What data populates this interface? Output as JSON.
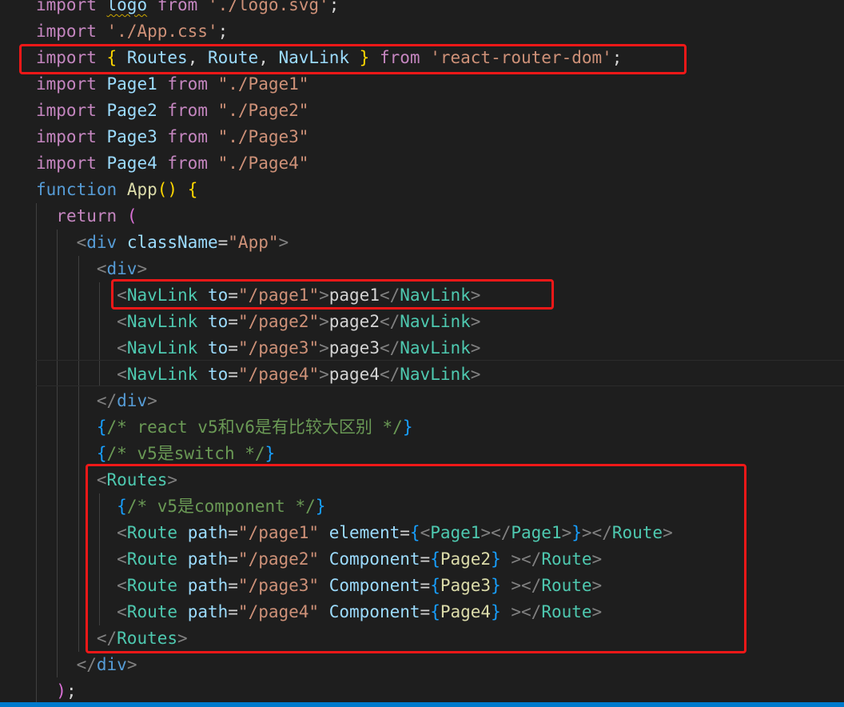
{
  "editor": {
    "language": "jsx",
    "theme_colors": {
      "background": "#1e1e1e",
      "keyword": "#c586c0",
      "storage": "#569cd6",
      "variable": "#9cdcfe",
      "function": "#dcdcaa",
      "string": "#ce9178",
      "component": "#4ec9b0",
      "comment": "#6a9955",
      "punctuation": "#808080",
      "text": "#d4d4d4",
      "bracket_gold": "#ffd700",
      "bracket_purple": "#da70d6",
      "bracket_blue": "#179fff",
      "highlight_box": "#f01818",
      "status_bar": "#007acc"
    },
    "lines": [
      [
        {
          "t": "import",
          "c": "keyword"
        },
        {
          "t": " "
        },
        {
          "t": "logo",
          "c": "variable",
          "squiggle": true
        },
        {
          "t": " "
        },
        {
          "t": "from",
          "c": "keyword"
        },
        {
          "t": " "
        },
        {
          "t": "'./logo.svg'",
          "c": "string"
        },
        {
          "t": ";"
        }
      ],
      [
        {
          "t": "import",
          "c": "keyword"
        },
        {
          "t": " "
        },
        {
          "t": "'./App.css'",
          "c": "string"
        },
        {
          "t": ";"
        }
      ],
      [
        {
          "t": "import",
          "c": "keyword"
        },
        {
          "t": " "
        },
        {
          "t": "{",
          "c": "bracket_gold"
        },
        {
          "t": " "
        },
        {
          "t": "Routes",
          "c": "variable"
        },
        {
          "t": ", "
        },
        {
          "t": "Route",
          "c": "variable"
        },
        {
          "t": ", "
        },
        {
          "t": "NavLink",
          "c": "variable"
        },
        {
          "t": " "
        },
        {
          "t": "}",
          "c": "bracket_gold"
        },
        {
          "t": " "
        },
        {
          "t": "from",
          "c": "keyword"
        },
        {
          "t": " "
        },
        {
          "t": "'react-router-dom'",
          "c": "string"
        },
        {
          "t": ";"
        }
      ],
      [
        {
          "t": "import",
          "c": "keyword"
        },
        {
          "t": " "
        },
        {
          "t": "Page1",
          "c": "variable"
        },
        {
          "t": " "
        },
        {
          "t": "from",
          "c": "keyword"
        },
        {
          "t": " "
        },
        {
          "t": "\"./Page1\"",
          "c": "string"
        }
      ],
      [
        {
          "t": "import",
          "c": "keyword"
        },
        {
          "t": " "
        },
        {
          "t": "Page2",
          "c": "variable"
        },
        {
          "t": " "
        },
        {
          "t": "from",
          "c": "keyword"
        },
        {
          "t": " "
        },
        {
          "t": "\"./Page2\"",
          "c": "string"
        }
      ],
      [
        {
          "t": "import",
          "c": "keyword"
        },
        {
          "t": " "
        },
        {
          "t": "Page3",
          "c": "variable"
        },
        {
          "t": " "
        },
        {
          "t": "from",
          "c": "keyword"
        },
        {
          "t": " "
        },
        {
          "t": "\"./Page3\"",
          "c": "string"
        }
      ],
      [
        {
          "t": "import",
          "c": "keyword"
        },
        {
          "t": " "
        },
        {
          "t": "Page4",
          "c": "variable"
        },
        {
          "t": " "
        },
        {
          "t": "from",
          "c": "keyword"
        },
        {
          "t": " "
        },
        {
          "t": "\"./Page4\"",
          "c": "string"
        }
      ],
      [
        {
          "t": "function",
          "c": "storage"
        },
        {
          "t": " "
        },
        {
          "t": "App",
          "c": "function"
        },
        {
          "t": "()",
          "c": "bracket_gold"
        },
        {
          "t": " "
        },
        {
          "t": "{",
          "c": "bracket_gold"
        }
      ],
      [
        {
          "t": "  "
        },
        {
          "t": "return",
          "c": "keyword"
        },
        {
          "t": " "
        },
        {
          "t": "(",
          "c": "bracket_purple"
        }
      ],
      [
        {
          "t": "    "
        },
        {
          "t": "<",
          "c": "punctuation"
        },
        {
          "t": "div",
          "c": "storage"
        },
        {
          "t": " "
        },
        {
          "t": "className",
          "c": "variable"
        },
        {
          "t": "="
        },
        {
          "t": "\"App\"",
          "c": "string"
        },
        {
          "t": ">",
          "c": "punctuation"
        }
      ],
      [
        {
          "t": "      "
        },
        {
          "t": "<",
          "c": "punctuation"
        },
        {
          "t": "div",
          "c": "storage"
        },
        {
          "t": ">",
          "c": "punctuation"
        }
      ],
      [
        {
          "t": "        "
        },
        {
          "t": "<",
          "c": "punctuation"
        },
        {
          "t": "NavLink",
          "c": "component"
        },
        {
          "t": " "
        },
        {
          "t": "to",
          "c": "variable"
        },
        {
          "t": "="
        },
        {
          "t": "\"/page1\"",
          "c": "string"
        },
        {
          "t": ">",
          "c": "punctuation"
        },
        {
          "t": "page1"
        },
        {
          "t": "</",
          "c": "punctuation"
        },
        {
          "t": "NavLink",
          "c": "component"
        },
        {
          "t": ">",
          "c": "punctuation"
        }
      ],
      [
        {
          "t": "        "
        },
        {
          "t": "<",
          "c": "punctuation"
        },
        {
          "t": "NavLink",
          "c": "component"
        },
        {
          "t": " "
        },
        {
          "t": "to",
          "c": "variable"
        },
        {
          "t": "="
        },
        {
          "t": "\"/page2\"",
          "c": "string"
        },
        {
          "t": ">",
          "c": "punctuation"
        },
        {
          "t": "page2"
        },
        {
          "t": "</",
          "c": "punctuation"
        },
        {
          "t": "NavLink",
          "c": "component"
        },
        {
          "t": ">",
          "c": "punctuation"
        }
      ],
      [
        {
          "t": "        "
        },
        {
          "t": "<",
          "c": "punctuation"
        },
        {
          "t": "NavLink",
          "c": "component"
        },
        {
          "t": " "
        },
        {
          "t": "to",
          "c": "variable"
        },
        {
          "t": "="
        },
        {
          "t": "\"/page3\"",
          "c": "string"
        },
        {
          "t": ">",
          "c": "punctuation"
        },
        {
          "t": "page3"
        },
        {
          "t": "</",
          "c": "punctuation"
        },
        {
          "t": "NavLink",
          "c": "component"
        },
        {
          "t": ">",
          "c": "punctuation"
        }
      ],
      [
        {
          "t": "        "
        },
        {
          "t": "<",
          "c": "punctuation"
        },
        {
          "t": "NavLink",
          "c": "component"
        },
        {
          "t": " "
        },
        {
          "t": "to",
          "c": "variable"
        },
        {
          "t": "="
        },
        {
          "t": "\"/page4\"",
          "c": "string"
        },
        {
          "t": ">",
          "c": "punctuation"
        },
        {
          "t": "page4"
        },
        {
          "t": "</",
          "c": "punctuation"
        },
        {
          "t": "NavLink",
          "c": "component"
        },
        {
          "t": ">",
          "c": "punctuation"
        }
      ],
      [
        {
          "t": "      "
        },
        {
          "t": "</",
          "c": "punctuation"
        },
        {
          "t": "div",
          "c": "storage"
        },
        {
          "t": ">",
          "c": "punctuation"
        }
      ],
      [
        {
          "t": "      "
        },
        {
          "t": "{",
          "c": "bracket_blue"
        },
        {
          "t": "/* react v5和v6是有比较大区别 */",
          "c": "comment"
        },
        {
          "t": "}",
          "c": "bracket_blue"
        }
      ],
      [
        {
          "t": "      "
        },
        {
          "t": "{",
          "c": "bracket_blue"
        },
        {
          "t": "/* v5是switch */",
          "c": "comment"
        },
        {
          "t": "}",
          "c": "bracket_blue"
        }
      ],
      [
        {
          "t": "      "
        },
        {
          "t": "<",
          "c": "punctuation"
        },
        {
          "t": "Routes",
          "c": "component"
        },
        {
          "t": ">",
          "c": "punctuation"
        }
      ],
      [
        {
          "t": "        "
        },
        {
          "t": "{",
          "c": "bracket_blue"
        },
        {
          "t": "/* v5是component */",
          "c": "comment"
        },
        {
          "t": "}",
          "c": "bracket_blue"
        }
      ],
      [
        {
          "t": "        "
        },
        {
          "t": "<",
          "c": "punctuation"
        },
        {
          "t": "Route",
          "c": "component"
        },
        {
          "t": " "
        },
        {
          "t": "path",
          "c": "variable"
        },
        {
          "t": "="
        },
        {
          "t": "\"/page1\"",
          "c": "string"
        },
        {
          "t": " "
        },
        {
          "t": "element",
          "c": "variable"
        },
        {
          "t": "="
        },
        {
          "t": "{",
          "c": "bracket_blue"
        },
        {
          "t": "<",
          "c": "punctuation"
        },
        {
          "t": "Page1",
          "c": "component"
        },
        {
          "t": "></",
          "c": "punctuation"
        },
        {
          "t": "Page1",
          "c": "component"
        },
        {
          "t": ">",
          "c": "punctuation"
        },
        {
          "t": "}",
          "c": "bracket_blue"
        },
        {
          "t": "></",
          "c": "punctuation"
        },
        {
          "t": "Route",
          "c": "component"
        },
        {
          "t": ">",
          "c": "punctuation"
        }
      ],
      [
        {
          "t": "        "
        },
        {
          "t": "<",
          "c": "punctuation"
        },
        {
          "t": "Route",
          "c": "component"
        },
        {
          "t": " "
        },
        {
          "t": "path",
          "c": "variable"
        },
        {
          "t": "="
        },
        {
          "t": "\"/page2\"",
          "c": "string"
        },
        {
          "t": " "
        },
        {
          "t": "Component",
          "c": "variable"
        },
        {
          "t": "="
        },
        {
          "t": "{",
          "c": "bracket_blue"
        },
        {
          "t": "Page2",
          "c": "function"
        },
        {
          "t": "}",
          "c": "bracket_blue"
        },
        {
          "t": " "
        },
        {
          "t": "></",
          "c": "punctuation"
        },
        {
          "t": "Route",
          "c": "component"
        },
        {
          "t": ">",
          "c": "punctuation"
        }
      ],
      [
        {
          "t": "        "
        },
        {
          "t": "<",
          "c": "punctuation"
        },
        {
          "t": "Route",
          "c": "component"
        },
        {
          "t": " "
        },
        {
          "t": "path",
          "c": "variable"
        },
        {
          "t": "="
        },
        {
          "t": "\"/page3\"",
          "c": "string"
        },
        {
          "t": " "
        },
        {
          "t": "Component",
          "c": "variable"
        },
        {
          "t": "="
        },
        {
          "t": "{",
          "c": "bracket_blue"
        },
        {
          "t": "Page3",
          "c": "function"
        },
        {
          "t": "}",
          "c": "bracket_blue"
        },
        {
          "t": " "
        },
        {
          "t": "></",
          "c": "punctuation"
        },
        {
          "t": "Route",
          "c": "component"
        },
        {
          "t": ">",
          "c": "punctuation"
        }
      ],
      [
        {
          "t": "        "
        },
        {
          "t": "<",
          "c": "punctuation"
        },
        {
          "t": "Route",
          "c": "component"
        },
        {
          "t": " "
        },
        {
          "t": "path",
          "c": "variable"
        },
        {
          "t": "="
        },
        {
          "t": "\"/page4\"",
          "c": "string"
        },
        {
          "t": " "
        },
        {
          "t": "Component",
          "c": "variable"
        },
        {
          "t": "="
        },
        {
          "t": "{",
          "c": "bracket_blue"
        },
        {
          "t": "Page4",
          "c": "function"
        },
        {
          "t": "}",
          "c": "bracket_blue"
        },
        {
          "t": " "
        },
        {
          "t": "></",
          "c": "punctuation"
        },
        {
          "t": "Route",
          "c": "component"
        },
        {
          "t": ">",
          "c": "punctuation"
        }
      ],
      [
        {
          "t": "      "
        },
        {
          "t": "</",
          "c": "punctuation"
        },
        {
          "t": "Routes",
          "c": "component"
        },
        {
          "t": ">",
          "c": "punctuation"
        }
      ],
      [
        {
          "t": "    "
        },
        {
          "t": "</",
          "c": "punctuation"
        },
        {
          "t": "div",
          "c": "storage"
        },
        {
          "t": ">",
          "c": "punctuation"
        }
      ],
      [
        {
          "t": "  "
        },
        {
          "t": ")",
          "c": "bracket_purple"
        },
        {
          "t": ";"
        }
      ]
    ]
  }
}
